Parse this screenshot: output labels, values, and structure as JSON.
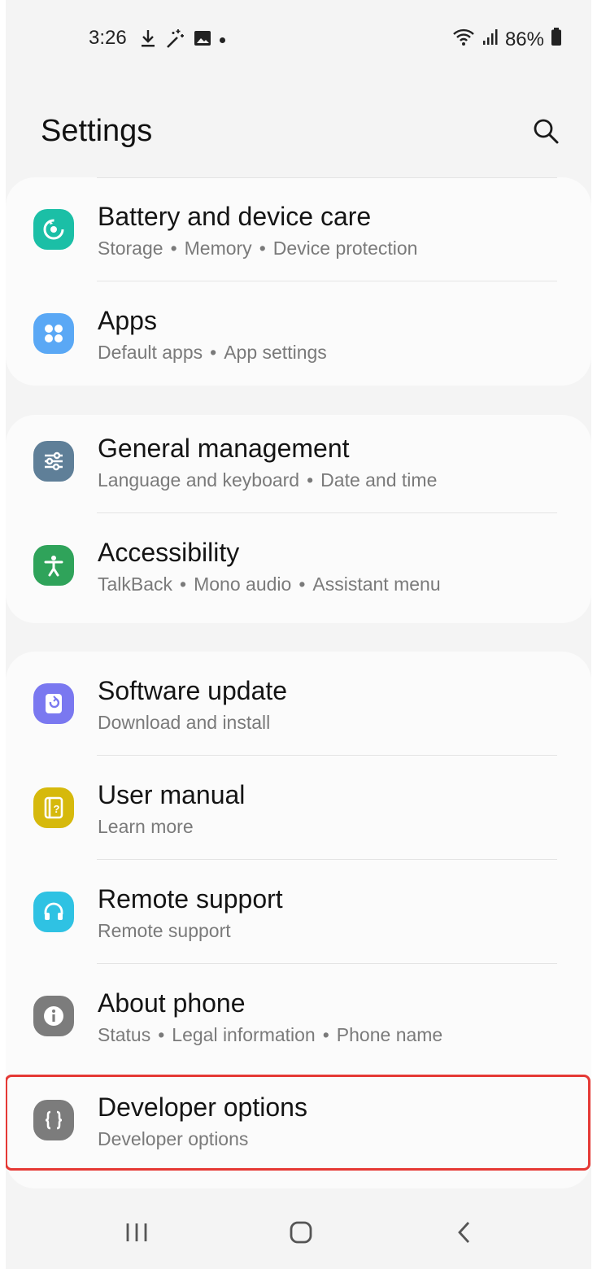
{
  "status_bar": {
    "time": "3:26",
    "battery": "86%",
    "left_icons": [
      "download-icon",
      "magic-wand-icon",
      "image-icon",
      "notification-dot"
    ],
    "right_icons": [
      "wifi-icon",
      "signal-icon",
      "battery-icon"
    ]
  },
  "header": {
    "title": "Settings",
    "search_icon": "search-icon"
  },
  "groups": [
    {
      "items": [
        {
          "title": "Battery and device care",
          "subtitle": [
            "Storage",
            "Memory",
            "Device protection"
          ],
          "icon": "device-care-icon",
          "color": "#1bbfa6"
        },
        {
          "title": "Apps",
          "subtitle": [
            "Default apps",
            "App settings"
          ],
          "icon": "apps-icon",
          "color": "#5aa8f5"
        }
      ]
    },
    {
      "items": [
        {
          "title": "General management",
          "subtitle": [
            "Language and keyboard",
            "Date and time"
          ],
          "icon": "sliders-icon",
          "color": "#5f7f98"
        },
        {
          "title": "Accessibility",
          "subtitle": [
            "TalkBack",
            "Mono audio",
            "Assistant menu"
          ],
          "icon": "accessibility-icon",
          "color": "#2fa35a"
        }
      ]
    },
    {
      "items": [
        {
          "title": "Software update",
          "subtitle": [
            "Download and install"
          ],
          "icon": "software-update-icon",
          "color": "#7a78f0"
        },
        {
          "title": "User manual",
          "subtitle": [
            "Learn more"
          ],
          "icon": "user-manual-icon",
          "color": "#d6b90c"
        },
        {
          "title": "Remote support",
          "subtitle": [
            "Remote support"
          ],
          "icon": "headset-icon",
          "color": "#2fc2e3"
        },
        {
          "title": "About phone",
          "subtitle": [
            "Status",
            "Legal information",
            "Phone name"
          ],
          "icon": "info-icon",
          "color": "#7c7c7c"
        },
        {
          "title": "Developer options",
          "subtitle": [
            "Developer options"
          ],
          "icon": "developer-braces-icon",
          "color": "#7c7c7c"
        }
      ]
    }
  ],
  "navbar": {
    "icons": [
      "recent-apps-icon",
      "home-icon",
      "back-icon"
    ]
  },
  "colors": {
    "background": "#f4f4f4",
    "card": "#fbfbfb",
    "highlight": "#e53935"
  }
}
